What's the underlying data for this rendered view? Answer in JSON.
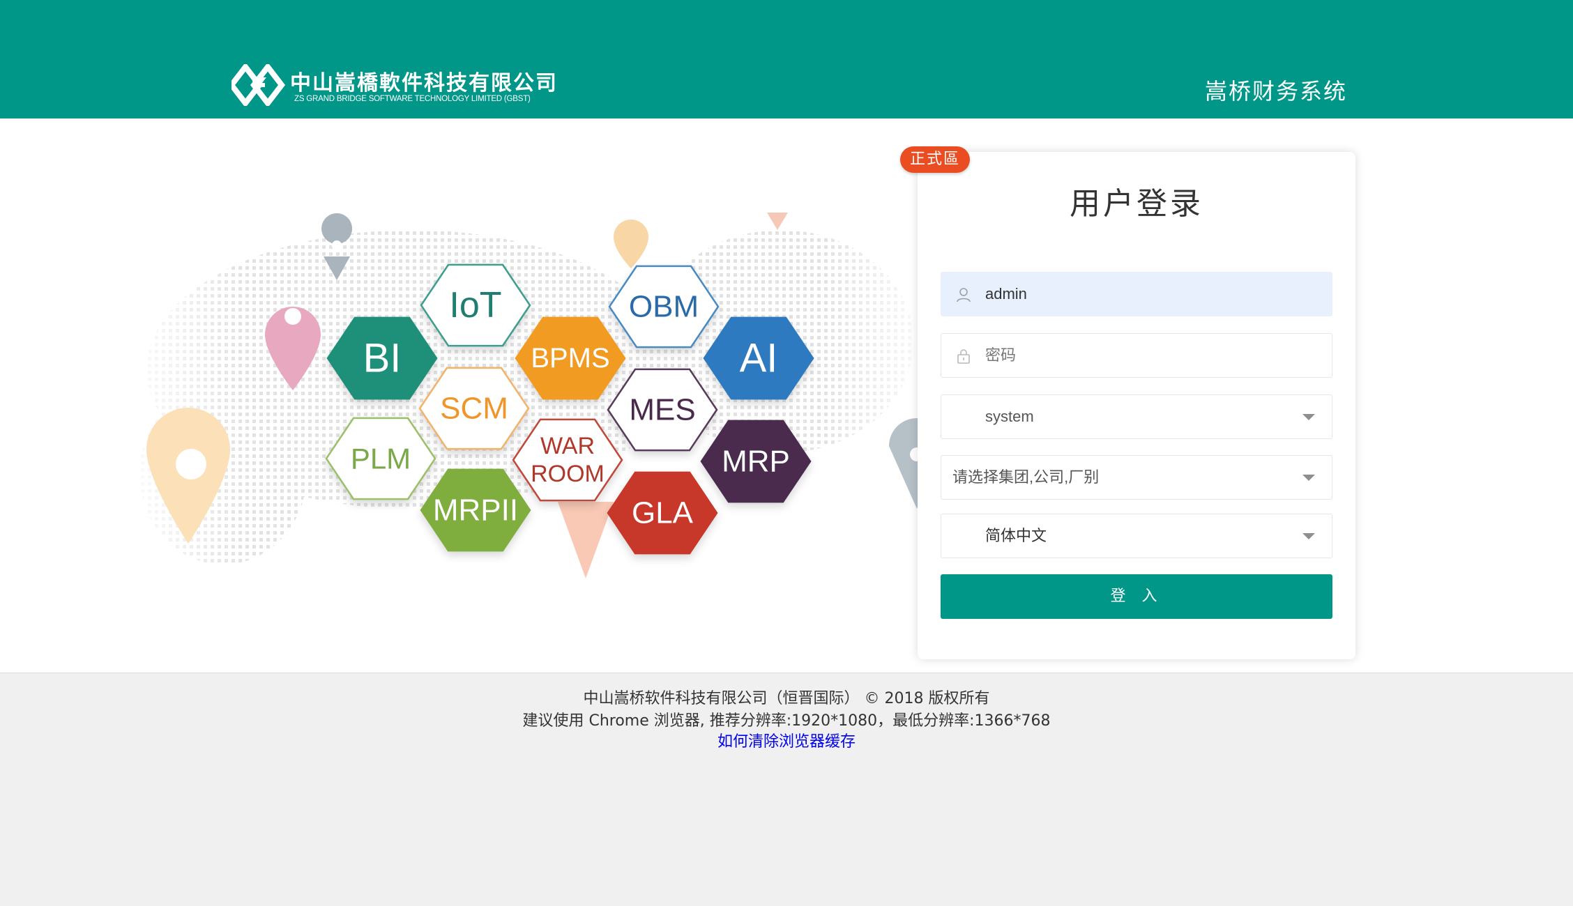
{
  "header": {
    "company_cn": "中山嵩橋軟件科技有限公司",
    "company_en": "ZS GRAND BRIDGE SOFTWARE TECHNOLOGY LIMITED (GBST)",
    "system_title": "嵩桥财务系统",
    "bg_color": "#009688"
  },
  "banner": {
    "hexagons": [
      "IoT",
      "OBM",
      "BI",
      "BPMS",
      "AI",
      "SCM",
      "MES",
      "PLM",
      "WAR",
      "ROOM",
      "MRP",
      "MRPII",
      "GLA"
    ]
  },
  "login": {
    "badge": "正式區",
    "title": "用户登录",
    "username": {
      "value": "admin",
      "icon": "user-icon"
    },
    "password": {
      "placeholder": "密码",
      "icon": "lock-icon"
    },
    "system_select": {
      "value": "system"
    },
    "org_select": {
      "placeholder": "请选择集团,公司,厂别"
    },
    "language_select": {
      "value": "简体中文"
    },
    "submit_label": "登 入",
    "accent_color": "#009688",
    "badge_color": "#ea4d21"
  },
  "footer": {
    "copyright": "中山嵩桥软件科技有限公司（恒晋国际） © 2018 版权所有",
    "browser_note": "建议使用 Chrome 浏览器, 推荐分辨率:1920*1080，最低分辨率:1366*768",
    "clear_cache_link": "如何清除浏览器缓存"
  }
}
